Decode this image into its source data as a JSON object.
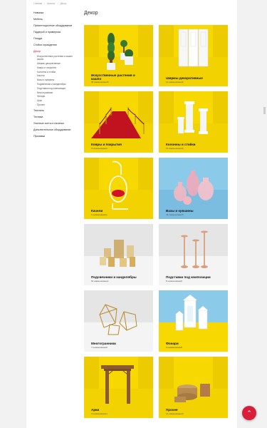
{
  "breadcrumb": [
    "Главная",
    "Каталог",
    "Декор"
  ],
  "sidebar": {
    "items": [
      {
        "label": "Новинки"
      },
      {
        "label": "Мебель"
      },
      {
        "label": "Презентационное оборудование"
      },
      {
        "label": "Гардероб и примерная"
      },
      {
        "label": "Посуда"
      },
      {
        "label": "Стойки ограждения"
      },
      {
        "label": "Декор",
        "active": true
      }
    ],
    "subitems": [
      "Искусственные растения и кашпо",
      "Ширмы декоративные",
      "Ковры и покрытия",
      "Колонны и стойки",
      "Качели",
      "Вазы и кувшины",
      "Подсвечники и канделябры",
      "Подставки под композиции",
      "Многогранники",
      "Фонари",
      "Арки",
      "Прочее"
    ],
    "items_after": [
      {
        "label": "Текстиль"
      },
      {
        "label": "Техника"
      },
      {
        "label": "Уличные зонты и палатки"
      },
      {
        "label": "Дополнительное оборудование"
      },
      {
        "label": "Прилавки"
      }
    ]
  },
  "page_title": "Декор",
  "cards": [
    {
      "title": "Искусственные растения и",
      "title2": "кашпо",
      "count": "36 наименований",
      "scene": "yellow"
    },
    {
      "title": "Ширмы декоративные",
      "count": "12 наименований",
      "scene": "yellow"
    },
    {
      "title": "Ковры и покрытия",
      "count": "3 наименования",
      "scene": "yellow"
    },
    {
      "title": "Колонны и стойки",
      "count": "15 наименований",
      "scene": "yellow"
    },
    {
      "title": "Качели",
      "count": "1 наименование",
      "scene": "yellow"
    },
    {
      "title": "Вазы и кувшины",
      "count": "46 наименований",
      "scene": "blue"
    },
    {
      "title": "Подсвечники и канделябры",
      "count": "64 наименования",
      "scene": "grey"
    },
    {
      "title": "Подставки под композиции",
      "count": "5 наименований",
      "scene": "grey"
    },
    {
      "title": "Многогранники",
      "count": "7 наименований",
      "scene": "grey"
    },
    {
      "title": "Фонари",
      "count": "6 наименований",
      "scene": "blue"
    },
    {
      "title": "Арки",
      "count": "3 наименования",
      "scene": "yellow"
    },
    {
      "title": "Прочее",
      "count": "14 наименований",
      "scene": "yellow"
    }
  ],
  "colors": {
    "yellow": "#f7d800",
    "yellow_floor": "#f1cf00",
    "yellow_wall": "#e9c400",
    "blue": "#8ccaea",
    "blue_floor": "#7bbde0",
    "grey": "#e5e5e5",
    "grey_floor": "#d7d7d7",
    "accent": "#e0003c"
  },
  "fab_icon": "chevron-up-icon"
}
